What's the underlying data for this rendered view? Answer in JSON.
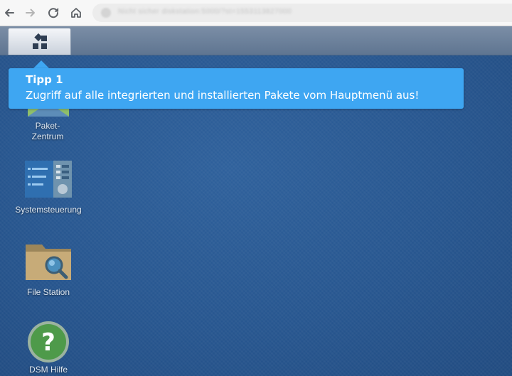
{
  "browser": {
    "back_icon": "back-arrow-icon",
    "forward_icon": "forward-arrow-icon",
    "reload_icon": "reload-icon",
    "home_icon": "home-icon",
    "address_text": "Nicht sicher   diskstation:5000/?st=1553113827000"
  },
  "taskbar": {
    "main_menu_icon": "main-menu-icon"
  },
  "desktop": {
    "icons": [
      {
        "label": "Paket-\nZentrum",
        "icon": "package-center-icon"
      },
      {
        "label": "Systemsteuerung",
        "icon": "control-panel-icon"
      },
      {
        "label": "File Station",
        "icon": "file-station-icon"
      },
      {
        "label": "DSM Hilfe",
        "icon": "help-icon"
      }
    ]
  },
  "tooltip": {
    "title": "Tipp 1",
    "text": "Zugriff auf alle integrierten und installierten Pakete vom Hauptmenü aus!"
  },
  "colors": {
    "tooltip_bg": "#3ea6f2",
    "desktop_bg": "#2a5790",
    "taskbar_bg": "#6a7f99"
  }
}
